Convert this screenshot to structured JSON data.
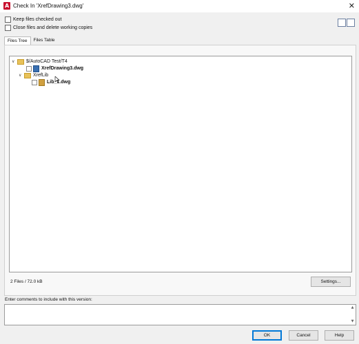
{
  "window": {
    "title": "Check In 'XrefDrawing3.dwg'"
  },
  "options": {
    "keep_checked_out": "Keep files checked out",
    "close_and_delete": "Close files and delete working copies"
  },
  "tabs": [
    "Files Tree",
    "Files Table"
  ],
  "tree": {
    "root": "$/AutoCAD Test/T4",
    "file1": "XrefDrawing3.dwg",
    "folder": "XrefLib",
    "file2": "Lib_1.dwg"
  },
  "summary": "2 Files / 72.0 kB",
  "settings_label": "Settings...",
  "comment_label": "Enter comments to include with this version:",
  "buttons": {
    "ok": "OK",
    "cancel": "Cancel",
    "help": "Help"
  },
  "colors": {
    "accent": "#0078d7",
    "app_icon": "#c8102e",
    "folder": "#e8c25a"
  }
}
